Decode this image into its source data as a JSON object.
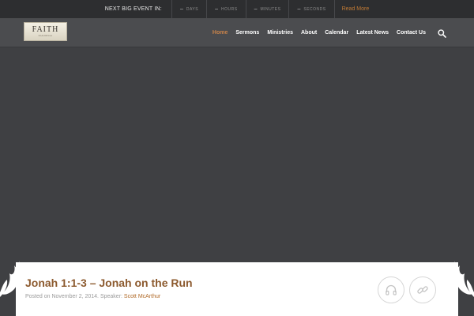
{
  "event_bar": {
    "label": "NEXT BIG EVENT IN:",
    "countdown": [
      {
        "value": "–",
        "unit": "DAYS"
      },
      {
        "value": "–",
        "unit": "HOURS"
      },
      {
        "value": "–",
        "unit": "MINUTES"
      },
      {
        "value": "–",
        "unit": "SECONDS"
      }
    ],
    "read_more": "Read More"
  },
  "header": {
    "logo": {
      "word": "FAITH",
      "sub": "CHURCH"
    },
    "nav": [
      "Home",
      "Sermons",
      "Ministries",
      "About",
      "Calendar",
      "Latest News",
      "Contact Us"
    ],
    "active_nav": "Home",
    "search_icon": "search-icon"
  },
  "post": {
    "title": "Jonah 1:1-3 – Jonah on the Run",
    "meta_prefix": "Posted on November 2, 2014. Speaker: ",
    "speaker": "Scott McArthur",
    "actions": [
      "headphones-icon",
      "link-icon"
    ]
  },
  "colors": {
    "accent": "#c07a35",
    "title": "#8c5a2e",
    "header_bg": "#4b4c4f",
    "topbar_bg": "#2d2e30",
    "hero_bg": "#3f4043"
  }
}
